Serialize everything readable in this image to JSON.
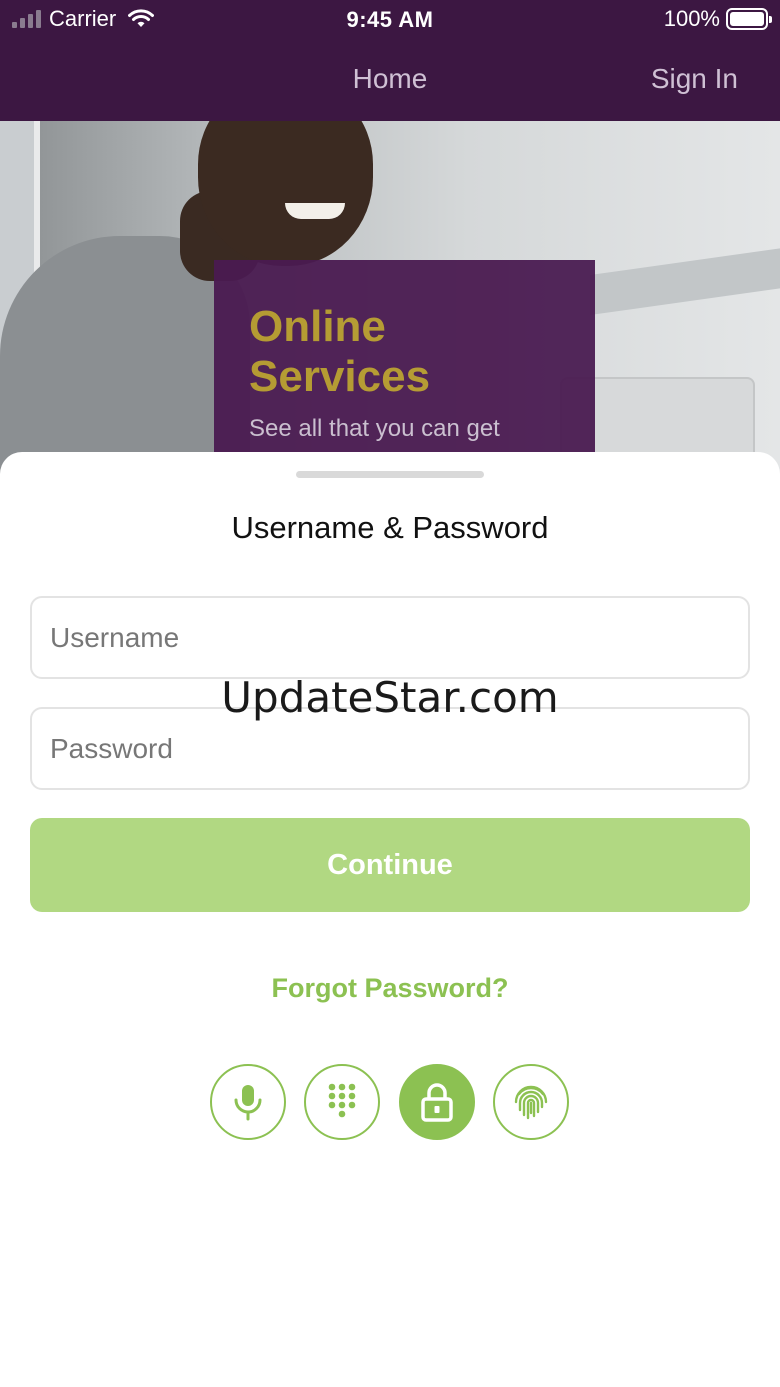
{
  "status_bar": {
    "carrier": "Carrier",
    "time": "9:45 AM",
    "battery": "100%"
  },
  "nav": {
    "home": "Home",
    "sign_in": "Sign In"
  },
  "hero": {
    "title_line1": "Online",
    "title_line2": "Services",
    "subtitle": "See all that you can get"
  },
  "login": {
    "title": "Username & Password",
    "username_placeholder": "Username",
    "password_placeholder": "Password",
    "continue_label": "Continue",
    "forgot_label": "Forgot Password?"
  },
  "auth_methods": [
    {
      "icon": "microphone-icon",
      "active": false
    },
    {
      "icon": "keypad-icon",
      "active": false
    },
    {
      "icon": "lock-icon",
      "active": true
    },
    {
      "icon": "fingerprint-icon",
      "active": false
    }
  ],
  "watermark": "UpdateStar.com",
  "colors": {
    "header_bg": "#3c1742",
    "promo_bg": "#4a1b51",
    "promo_title": "#b59a2c",
    "accent_green": "#8cc152",
    "button_green": "#b1d882"
  }
}
